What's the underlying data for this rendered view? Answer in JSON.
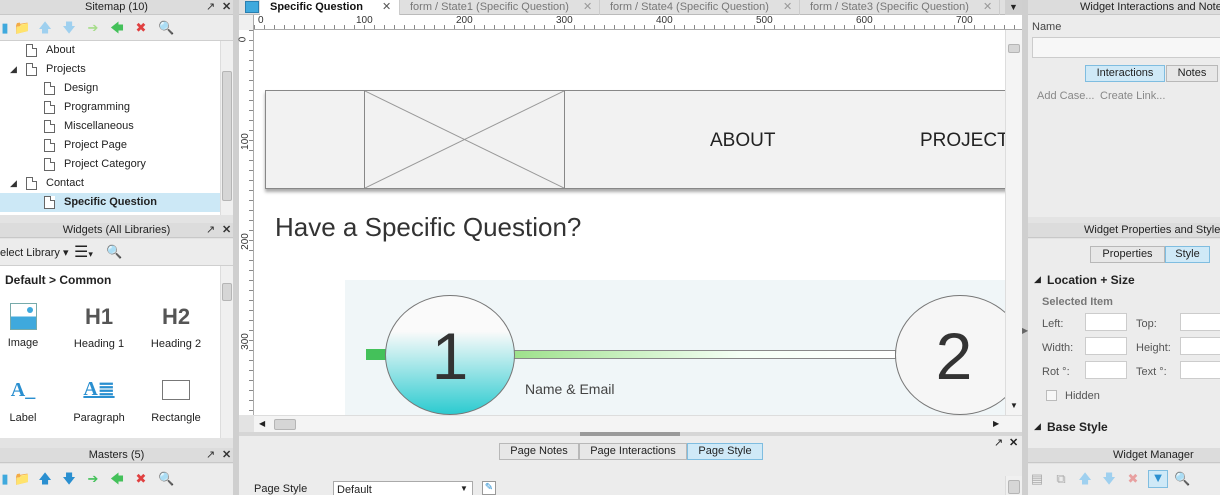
{
  "sitemap": {
    "title": "Sitemap (10)",
    "items": [
      {
        "label": "About",
        "indent": 1
      },
      {
        "label": "Projects",
        "indent": 1,
        "expanded": true
      },
      {
        "label": "Design",
        "indent": 2
      },
      {
        "label": "Programming",
        "indent": 2
      },
      {
        "label": "Miscellaneous",
        "indent": 2
      },
      {
        "label": "Project Page",
        "indent": 2
      },
      {
        "label": "Project Category",
        "indent": 2
      },
      {
        "label": "Contact",
        "indent": 1,
        "expanded": true
      },
      {
        "label": "Specific Question",
        "indent": 2,
        "selected": true
      }
    ]
  },
  "widgets": {
    "title": "Widgets (All Libraries)",
    "library_select": "elect Library",
    "section": "Default > Common",
    "items": [
      "Image",
      "Heading 1",
      "Heading 2",
      "Label",
      "Paragraph",
      "Rectangle"
    ],
    "glyphs": {
      "h1": "H1",
      "h2": "H2",
      "label": "A_",
      "paragraph": "A≣"
    }
  },
  "masters": {
    "title": "Masters (5)"
  },
  "tabs": {
    "active": "Specific Question",
    "others": [
      "form / State1 (Specific Question)",
      "form / State4 (Specific Question)",
      "form / State3 (Specific Question)"
    ]
  },
  "ruler": {
    "h_labels": [
      "0",
      "100",
      "200",
      "300",
      "400",
      "500",
      "600",
      "700"
    ],
    "v_labels": [
      "0",
      "100",
      "200",
      "300"
    ]
  },
  "canvas": {
    "nav": [
      "ABOUT",
      "PROJECT"
    ],
    "heading": "Have a Specific Question?",
    "step1": "1",
    "step2": "2",
    "step1_label": "Name & Email"
  },
  "bottom": {
    "tabs": [
      "Page Notes",
      "Page Interactions",
      "Page Style"
    ],
    "active_tab": "Page Style",
    "style_label": "Page Style",
    "style_value": "Default"
  },
  "interactions": {
    "title": "Widget Interactions and Notes",
    "name_label": "Name",
    "tabs": [
      "Interactions",
      "Notes"
    ],
    "add_case": "Add Case...",
    "create_link": "Create Link..."
  },
  "properties": {
    "title": "Widget Properties and Style",
    "tabs": [
      "Properties",
      "Style"
    ],
    "section": "Location + Size",
    "selected_item": "Selected Item",
    "fields": [
      "Left:",
      "Top:",
      "Width:",
      "Height:",
      "Rot °:",
      "Text °:"
    ],
    "hidden": "Hidden",
    "base_style": "Base Style"
  },
  "manager": {
    "title": "Widget Manager"
  },
  "colors": {
    "accent": "#3fa9dd",
    "selected": "#cce8f6",
    "panel": "#dcdcdc",
    "green": "#44c15a",
    "teal": "#2ccbd0"
  }
}
